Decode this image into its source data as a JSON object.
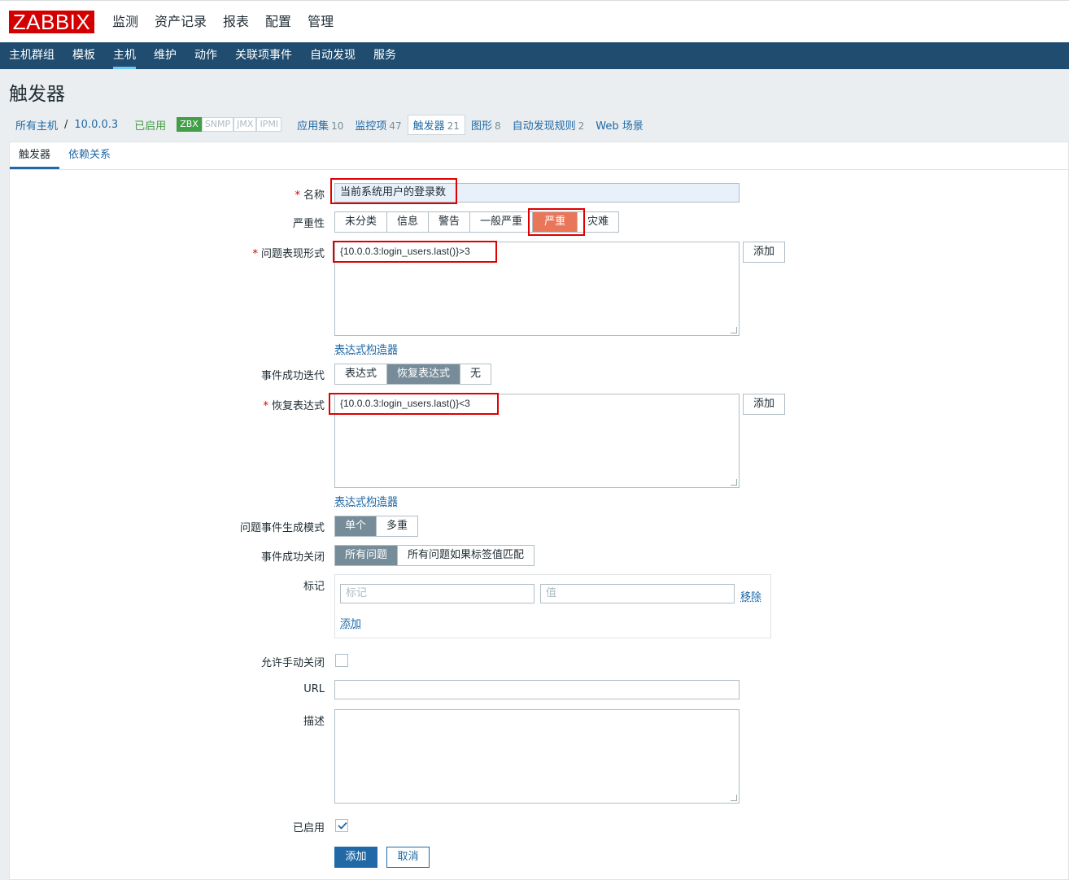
{
  "brand": {
    "logo": "ZABBIX"
  },
  "top_menu": [
    {
      "label": "监测"
    },
    {
      "label": "资产记录"
    },
    {
      "label": "报表"
    },
    {
      "label": "配置"
    },
    {
      "label": "管理"
    }
  ],
  "sub_menu": [
    {
      "label": "主机群组"
    },
    {
      "label": "模板"
    },
    {
      "label": "主机"
    },
    {
      "label": "维护"
    },
    {
      "label": "动作"
    },
    {
      "label": "关联项事件"
    },
    {
      "label": "自动发现"
    },
    {
      "label": "服务"
    }
  ],
  "page_title": "触发器",
  "breadcrumb": {
    "all_hosts": "所有主机",
    "separator": "/",
    "host": "10.0.0.3",
    "status": "已启用",
    "interfaces": [
      "ZBX",
      "SNMP",
      "JMX",
      "IPMI"
    ],
    "apps": {
      "label": "应用集",
      "count": "10"
    },
    "items": {
      "label": "监控项",
      "count": "47"
    },
    "triggers": {
      "label": "触发器",
      "count": "21"
    },
    "graphs": {
      "label": "图形",
      "count": "8"
    },
    "discovery": {
      "label": "自动发现规则",
      "count": "2"
    },
    "web": {
      "label": "Web 场景"
    }
  },
  "tabs": [
    {
      "label": "触发器"
    },
    {
      "label": "依赖关系"
    }
  ],
  "form": {
    "name": {
      "label": "名称",
      "value": "当前系统用户的登录数"
    },
    "severity": {
      "label": "严重性",
      "options": [
        "未分类",
        "信息",
        "警告",
        "一般严重",
        "严重",
        "灾难"
      ],
      "selected": "严重"
    },
    "problem_expr": {
      "label": "问题表现形式",
      "value": "{10.0.0.3:login_users.last()}>3",
      "add_label": "添加",
      "builder_label": "表达式构造器"
    },
    "ok_event_gen": {
      "label": "事件成功迭代",
      "options": [
        "表达式",
        "恢复表达式",
        "无"
      ],
      "selected": "恢复表达式"
    },
    "recovery_expr": {
      "label": "恢复表达式",
      "value": "{10.0.0.3:login_users.last()}<3",
      "add_label": "添加",
      "builder_label": "表达式构造器"
    },
    "gen_mode": {
      "label": "问题事件生成模式",
      "options": [
        "单个",
        "多重"
      ],
      "selected": "单个"
    },
    "ok_close": {
      "label": "事件成功关闭",
      "options": [
        "所有问题",
        "所有问题如果标签值匹配"
      ],
      "selected": "所有问题"
    },
    "tags": {
      "label": "标记",
      "tag_placeholder": "标记",
      "value_placeholder": "值",
      "remove_label": "移除",
      "add_label": "添加"
    },
    "manual_close": {
      "label": "允许手动关闭",
      "checked": false
    },
    "url": {
      "label": "URL",
      "value": ""
    },
    "description": {
      "label": "描述",
      "value": ""
    },
    "enabled": {
      "label": "已启用",
      "checked": true
    }
  },
  "actions": {
    "add": "添加",
    "cancel": "取消"
  },
  "colors": {
    "accent": "#2069a6",
    "header": "#1f4c6f",
    "logo": "#d40000",
    "severity_high": "#e97659",
    "highlight": "#e00000"
  }
}
